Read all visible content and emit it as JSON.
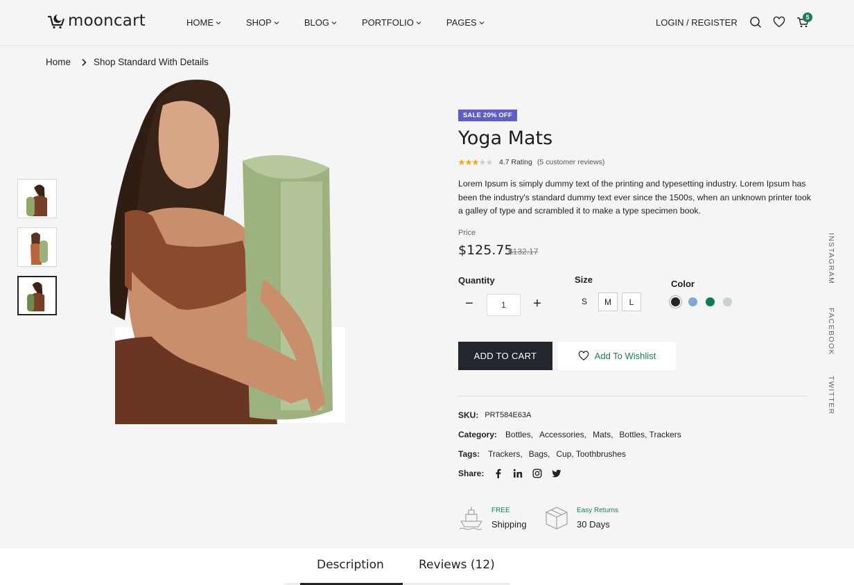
{
  "header": {
    "logo_text": "mooncart",
    "nav": [
      {
        "label": "HOME"
      },
      {
        "label": "SHOP"
      },
      {
        "label": "BLOG"
      },
      {
        "label": "PORTFOLIO"
      },
      {
        "label": "PAGES"
      }
    ],
    "login_label": "LOGIN / REGISTER",
    "cart_count": "5"
  },
  "breadcrumb": {
    "home": "Home",
    "current": "Shop Standard With Details"
  },
  "product": {
    "sale_badge": "SALE 20% OFF",
    "title": "Yoga Mats",
    "stars_filled": 3,
    "stars_total": 5,
    "rating_text": "4.7 Rating",
    "reviews_text": "(5 customer reviews)",
    "description": "Lorem Ipsum is simply dummy text of the printing and typesetting industry. Lorem Ipsum has been the industry's standard dummy text ever since the 1500s, when an unknown printer took a galley of type and scrambled it to make a type specimen book.",
    "price_label": "Price",
    "price": "$125.75",
    "old_price": "$132.17",
    "quantity_label": "Quantity",
    "quantity_value": "1",
    "size_label": "Size",
    "sizes": [
      "S",
      "M",
      "L"
    ],
    "color_label": "Color",
    "colors": [
      "#23262d",
      "#7fa8d4",
      "#13795b",
      "#c8d2d0"
    ],
    "add_to_cart": "ADD TO CART",
    "add_to_wishlist": "Add To Wishlist",
    "sku_label": "SKU:",
    "sku": "PRT584E63A",
    "category_label": "Category:",
    "categories": [
      "Bottles,",
      "Accessories,",
      "Mats,",
      "Bottles, Trackers"
    ],
    "tags_label": "Tags:",
    "tags": [
      "Trackers,",
      "Bags,",
      "Cup, Toothbrushes"
    ],
    "share_label": "Share:"
  },
  "features": [
    {
      "small": "FREE",
      "big": "Shipping"
    },
    {
      "small": "Easy Returns",
      "big": "30 Days"
    }
  ],
  "social": [
    "INSTAGRAM",
    "FACEBOOK",
    "TWITTER"
  ],
  "tabs": [
    {
      "label": "Description"
    },
    {
      "label": "Reviews (12)"
    }
  ],
  "colors": {
    "accent": "#1c7b5c",
    "badge": "#5b5fc7",
    "dark_button": "#23262d",
    "star": "#f5a623"
  }
}
